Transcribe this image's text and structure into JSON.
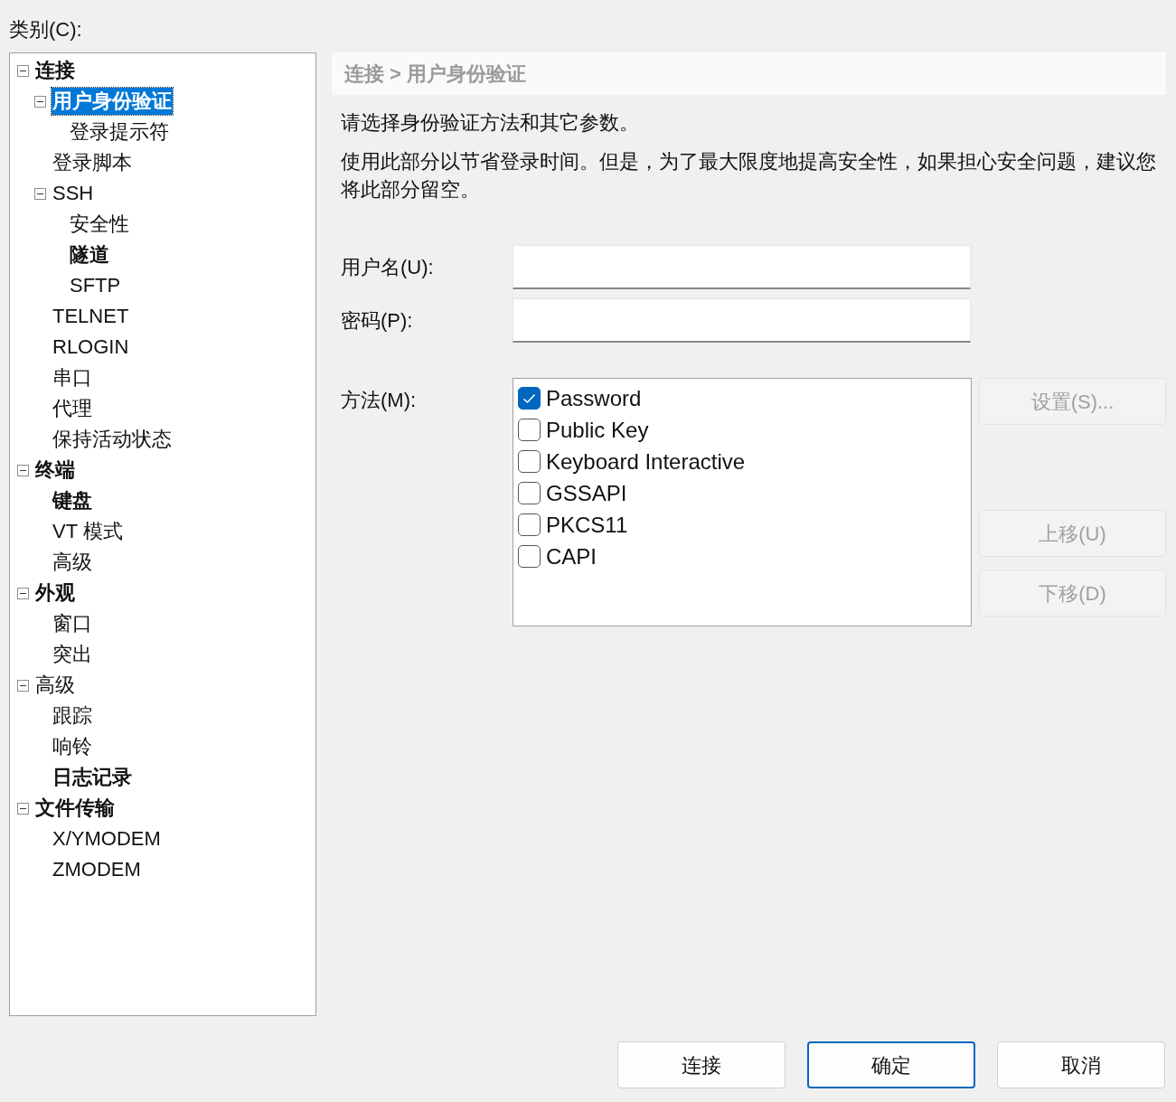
{
  "category_label": "类别(C):",
  "tree": [
    {
      "label": "连接",
      "bold": true,
      "selected": false,
      "expanded": true,
      "children": [
        {
          "label": "用户身份验证",
          "bold": true,
          "selected": true,
          "expanded": true,
          "children": [
            {
              "label": "登录提示符",
              "bold": false,
              "selected": false
            }
          ]
        },
        {
          "label": "登录脚本",
          "bold": false,
          "selected": false
        },
        {
          "label": "SSH",
          "bold": false,
          "selected": false,
          "expanded": true,
          "children": [
            {
              "label": "安全性",
              "bold": false,
              "selected": false
            },
            {
              "label": "隧道",
              "bold": true,
              "selected": false
            },
            {
              "label": "SFTP",
              "bold": false,
              "selected": false
            }
          ]
        },
        {
          "label": "TELNET",
          "bold": false,
          "selected": false
        },
        {
          "label": "RLOGIN",
          "bold": false,
          "selected": false
        },
        {
          "label": "串口",
          "bold": false,
          "selected": false
        },
        {
          "label": "代理",
          "bold": false,
          "selected": false
        },
        {
          "label": "保持活动状态",
          "bold": false,
          "selected": false
        }
      ]
    },
    {
      "label": "终端",
      "bold": true,
      "selected": false,
      "expanded": true,
      "children": [
        {
          "label": "键盘",
          "bold": true,
          "selected": false
        },
        {
          "label": "VT 模式",
          "bold": false,
          "selected": false
        },
        {
          "label": "高级",
          "bold": false,
          "selected": false
        }
      ]
    },
    {
      "label": "外观",
      "bold": true,
      "selected": false,
      "expanded": true,
      "children": [
        {
          "label": "窗口",
          "bold": false,
          "selected": false
        },
        {
          "label": "突出",
          "bold": false,
          "selected": false
        }
      ]
    },
    {
      "label": "高级",
      "bold": false,
      "selected": false,
      "expanded": true,
      "children": [
        {
          "label": "跟踪",
          "bold": false,
          "selected": false
        },
        {
          "label": "响铃",
          "bold": false,
          "selected": false
        },
        {
          "label": "日志记录",
          "bold": true,
          "selected": false
        }
      ]
    },
    {
      "label": "文件传输",
      "bold": true,
      "selected": false,
      "expanded": true,
      "children": [
        {
          "label": "X/YMODEM",
          "bold": false,
          "selected": false
        },
        {
          "label": "ZMODEM",
          "bold": false,
          "selected": false
        }
      ]
    }
  ],
  "breadcrumb": "连接 > 用户身份验证",
  "description": [
    "请选择身份验证方法和其它参数。",
    "使用此部分以节省登录时间。但是，为了最大限度地提高安全性，如果担心安全问题，建议您将此部分留空。"
  ],
  "fields": [
    {
      "label": "用户名(U):"
    },
    {
      "label": "密码(P):"
    }
  ],
  "method_label": "方法(M):",
  "methods": [
    {
      "label": "Password",
      "checked": true
    },
    {
      "label": "Public Key",
      "checked": false
    },
    {
      "label": "Keyboard Interactive",
      "checked": false
    },
    {
      "label": "GSSAPI",
      "checked": false
    },
    {
      "label": "PKCS11",
      "checked": false
    },
    {
      "label": "CAPI",
      "checked": false
    }
  ],
  "settings_button": {
    "label": "设置(S)...",
    "disabled": true
  },
  "move_buttons": [
    {
      "label": "上移(U)",
      "disabled": true
    },
    {
      "label": "下移(D)",
      "disabled": true
    }
  ],
  "footer_buttons": [
    {
      "label": "连接",
      "default": false
    },
    {
      "label": "确定",
      "default": true
    },
    {
      "label": "取消",
      "default": false
    }
  ]
}
